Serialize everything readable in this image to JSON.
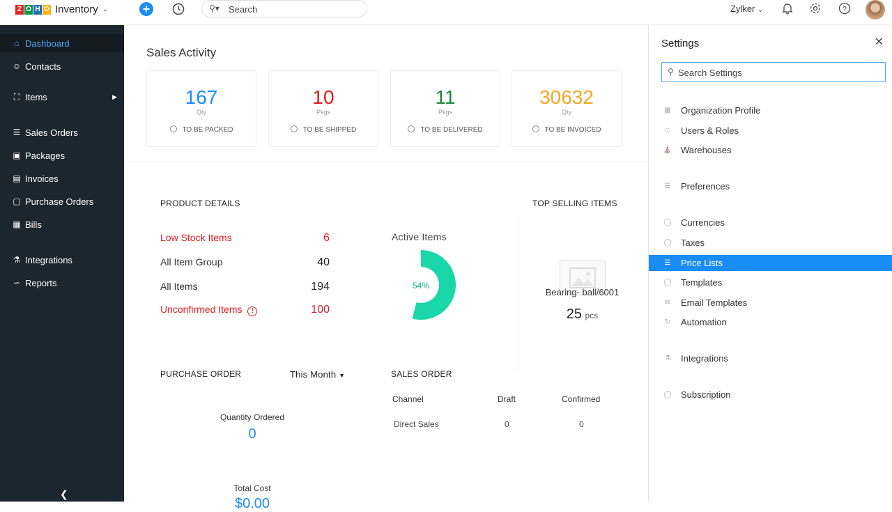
{
  "topbar": {
    "logo_letters": [
      "Z",
      "O",
      "H",
      "O"
    ],
    "logo_colors": [
      "#e42527",
      "#089949",
      "#226db4",
      "#f9b21d"
    ],
    "app_name": "Inventory",
    "search_placeholder": "Search",
    "org_name": "Zylker"
  },
  "sidebar": {
    "items": [
      {
        "label": "Dashboard",
        "icon": "home-icon"
      },
      {
        "label": "Contacts",
        "icon": "user-icon"
      },
      {
        "label": "Items",
        "icon": "basket-icon"
      },
      {
        "label": "Sales Orders",
        "icon": "cart-icon"
      },
      {
        "label": "Packages",
        "icon": "package-icon"
      },
      {
        "label": "Invoices",
        "icon": "invoice-icon"
      },
      {
        "label": "Purchase Orders",
        "icon": "bag-icon"
      },
      {
        "label": "Bills",
        "icon": "bill-icon"
      },
      {
        "label": "Integrations",
        "icon": "plug-icon"
      },
      {
        "label": "Reports",
        "icon": "chart-icon"
      }
    ]
  },
  "sales_activity": {
    "title": "Sales Activity",
    "cards": [
      {
        "value": "167",
        "unit": "Qty",
        "label": "TO BE PACKED",
        "color": "#1a8cf5"
      },
      {
        "value": "10",
        "unit": "Pkgs",
        "label": "TO BE SHIPPED",
        "color": "#e11b22"
      },
      {
        "value": "11",
        "unit": "Pkgs",
        "label": "TO BE DELIVERED",
        "color": "#1e8a3c"
      },
      {
        "value": "30632",
        "unit": "Qty",
        "label": "TO BE INVOICED",
        "color": "#f5a623"
      }
    ]
  },
  "product_details": {
    "title": "PRODUCT DETAILS",
    "rows": [
      {
        "label": "Low Stock Items",
        "value": "6"
      },
      {
        "label": "All Item Group",
        "value": "40"
      },
      {
        "label": "All Items",
        "value": "194"
      },
      {
        "label": "Unconfirmed Items",
        "value": "100"
      }
    ],
    "active_items_label": "Active Items",
    "active_percent_label": "54%",
    "active_fraction": 0.54
  },
  "top_selling": {
    "title": "TOP SELLING ITEMS",
    "item_name": "Bearing- ball/6001",
    "qty": "25",
    "qty_unit": "pcs"
  },
  "purchase_order": {
    "title": "PURCHASE ORDER",
    "period": "This Month",
    "qty_label": "Quantity Ordered",
    "qty_value": "0",
    "cost_label": "Total Cost",
    "cost_value": "$0.00"
  },
  "sales_order": {
    "title": "SALES ORDER",
    "headers": [
      "Channel",
      "Draft",
      "Confirmed"
    ],
    "rows": [
      [
        "Direct Sales",
        "0",
        "0"
      ]
    ]
  },
  "settings": {
    "title": "Settings",
    "search_placeholder": "Search Settings",
    "items": [
      "Organization Profile",
      "Users & Roles",
      "Warehouses",
      "Preferences",
      "Currencies",
      "Taxes",
      "Price Lists",
      "Templates",
      "Email Templates",
      "Automation",
      "Integrations",
      "Subscription"
    ],
    "active_item": "Price Lists"
  }
}
